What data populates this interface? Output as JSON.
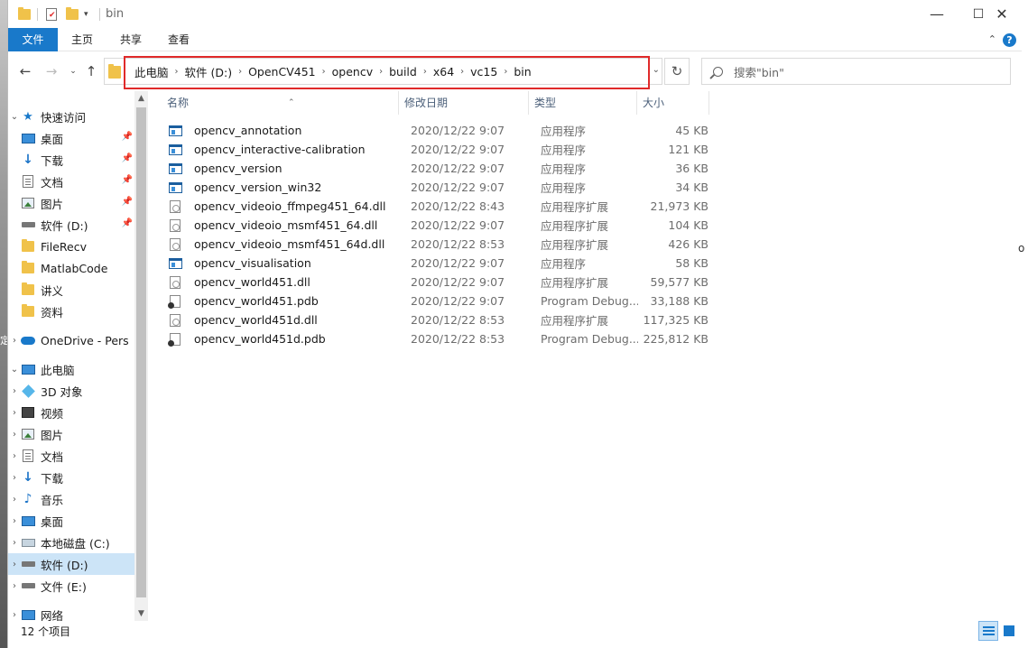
{
  "window": {
    "title": "bin",
    "minimize": "—",
    "maximize": "☐",
    "close": "✕"
  },
  "ribbon": {
    "tabs": [
      "文件",
      "主页",
      "共享",
      "查看"
    ],
    "collapse_icon": "chevron-up-icon",
    "help": "?"
  },
  "address": {
    "crumbs": [
      "此电脑",
      "软件 (D:)",
      "OpenCV451",
      "opencv",
      "build",
      "x64",
      "vc15",
      "bin"
    ],
    "refresh": "↻",
    "search_placeholder": "搜索\"bin\"",
    "highlight_color": "#e02a2a"
  },
  "nav": {
    "items": [
      {
        "label": "快速访问",
        "icon": "star-icon"
      },
      {
        "label": "桌面",
        "icon": "desktop-icon"
      },
      {
        "label": "下载",
        "icon": "download-icon"
      },
      {
        "label": "文档",
        "icon": "document-icon"
      },
      {
        "label": "图片",
        "icon": "picture-icon"
      },
      {
        "label": "软件 (D:)",
        "icon": "drive-icon"
      },
      {
        "label": "FileRecv",
        "icon": "folder-icon"
      },
      {
        "label": "MatlabCode",
        "icon": "folder-icon"
      },
      {
        "label": "讲义",
        "icon": "folder-icon"
      },
      {
        "label": "资料",
        "icon": "folder-icon"
      },
      {
        "label": "OneDrive - Pers",
        "icon": "onedrive-icon"
      },
      {
        "label": "此电脑",
        "icon": "computer-icon"
      },
      {
        "label": "3D 对象",
        "icon": "3d-objects-icon"
      },
      {
        "label": "视频",
        "icon": "video-icon"
      },
      {
        "label": "图片",
        "icon": "picture-icon"
      },
      {
        "label": "文档",
        "icon": "document-icon"
      },
      {
        "label": "下载",
        "icon": "download-icon"
      },
      {
        "label": "音乐",
        "icon": "music-icon"
      },
      {
        "label": "桌面",
        "icon": "desktop-icon"
      },
      {
        "label": "本地磁盘 (C:)",
        "icon": "local-disk-icon"
      },
      {
        "label": "软件 (D:)",
        "icon": "drive-icon"
      },
      {
        "label": "文件 (E:)",
        "icon": "drive-icon"
      },
      {
        "label": "网络",
        "icon": "network-icon"
      }
    ]
  },
  "columns": {
    "name": "名称",
    "date": "修改日期",
    "type": "类型",
    "size": "大小"
  },
  "files": [
    {
      "name": "opencv_annotation",
      "date": "2020/12/22 9:07",
      "type": "应用程序",
      "size": "45 KB",
      "icon": "exe"
    },
    {
      "name": "opencv_interactive-calibration",
      "date": "2020/12/22 9:07",
      "type": "应用程序",
      "size": "121 KB",
      "icon": "exe"
    },
    {
      "name": "opencv_version",
      "date": "2020/12/22 9:07",
      "type": "应用程序",
      "size": "36 KB",
      "icon": "exe"
    },
    {
      "name": "opencv_version_win32",
      "date": "2020/12/22 9:07",
      "type": "应用程序",
      "size": "34 KB",
      "icon": "exe"
    },
    {
      "name": "opencv_videoio_ffmpeg451_64.dll",
      "date": "2020/12/22 8:43",
      "type": "应用程序扩展",
      "size": "21,973 KB",
      "icon": "dll"
    },
    {
      "name": "opencv_videoio_msmf451_64.dll",
      "date": "2020/12/22 9:07",
      "type": "应用程序扩展",
      "size": "104 KB",
      "icon": "dll"
    },
    {
      "name": "opencv_videoio_msmf451_64d.dll",
      "date": "2020/12/22 8:53",
      "type": "应用程序扩展",
      "size": "426 KB",
      "icon": "dll"
    },
    {
      "name": "opencv_visualisation",
      "date": "2020/12/22 9:07",
      "type": "应用程序",
      "size": "58 KB",
      "icon": "exe"
    },
    {
      "name": "opencv_world451.dll",
      "date": "2020/12/22 9:07",
      "type": "应用程序扩展",
      "size": "59,577 KB",
      "icon": "dll"
    },
    {
      "name": "opencv_world451.pdb",
      "date": "2020/12/22 9:07",
      "type": "Program Debug...",
      "size": "33,188 KB",
      "icon": "pdb"
    },
    {
      "name": "opencv_world451d.dll",
      "date": "2020/12/22 8:53",
      "type": "应用程序扩展",
      "size": "117,325 KB",
      "icon": "dll"
    },
    {
      "name": "opencv_world451d.pdb",
      "date": "2020/12/22 8:53",
      "type": "Program Debug...",
      "size": "225,812 KB",
      "icon": "pdb"
    }
  ],
  "status": {
    "count": "12 个项目"
  },
  "edge": {
    "left_char": "定",
    "right_char": "o"
  }
}
